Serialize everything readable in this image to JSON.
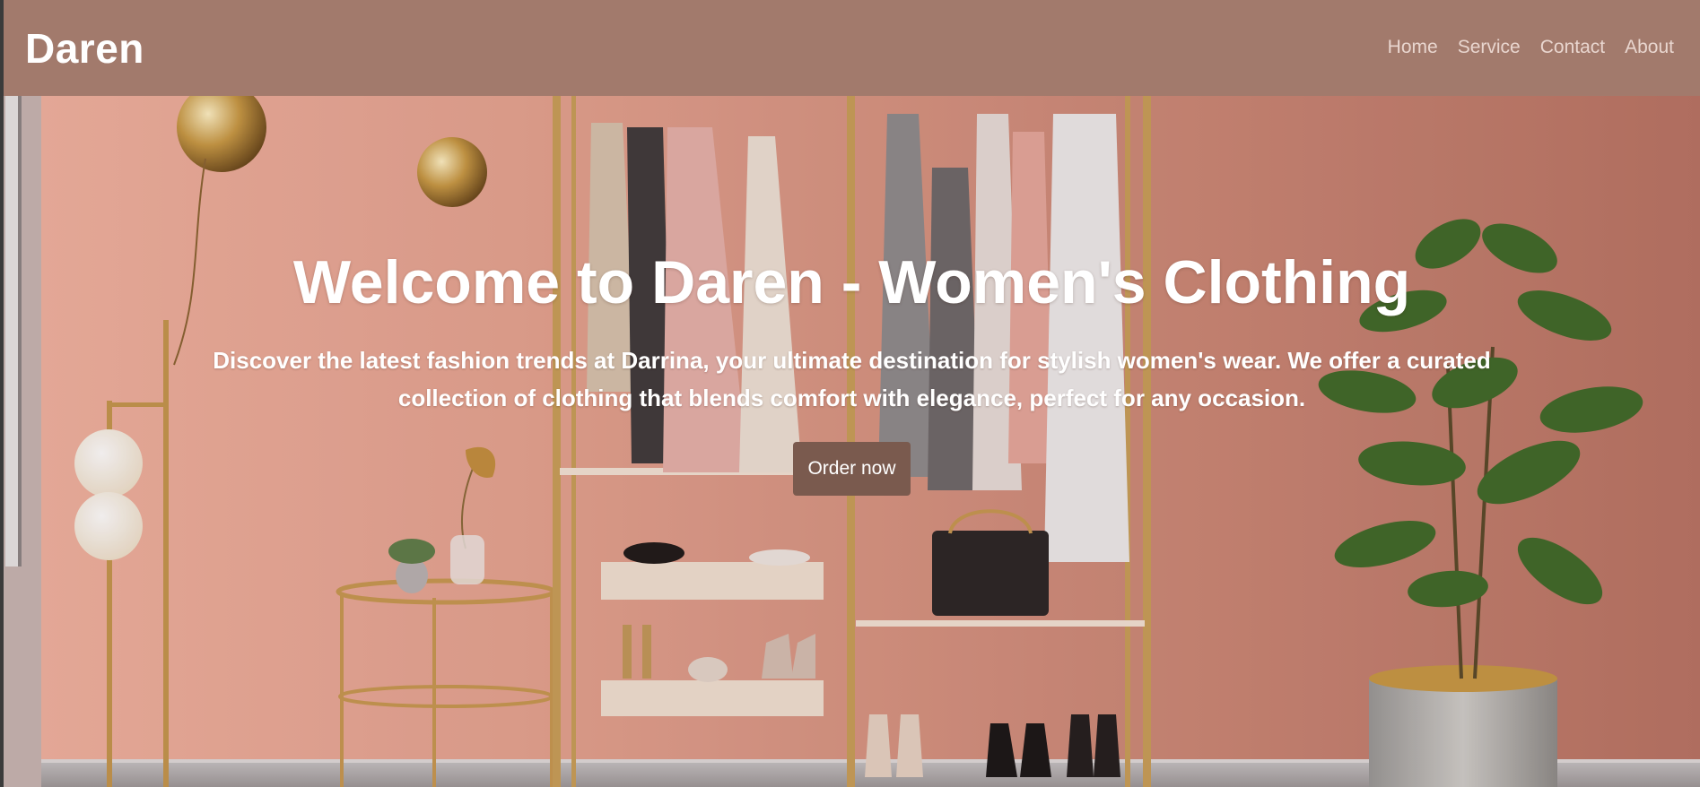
{
  "navbar": {
    "brand": "Daren",
    "links": [
      {
        "label": "Home"
      },
      {
        "label": "Service"
      },
      {
        "label": "Contact"
      },
      {
        "label": "About"
      }
    ]
  },
  "hero": {
    "title": "Welcome to Daren - Women's Clothing",
    "text": "Discover the latest fashion trends at Darrina, your ultimate destination for stylish women's wear. We offer a curated collection of clothing that blends comfort with elegance, perfect for any occasion.",
    "cta_label": "Order now"
  },
  "colors": {
    "navbar": "#a27a6c",
    "button": "#7a5a4e",
    "wall": "#d79b88"
  }
}
